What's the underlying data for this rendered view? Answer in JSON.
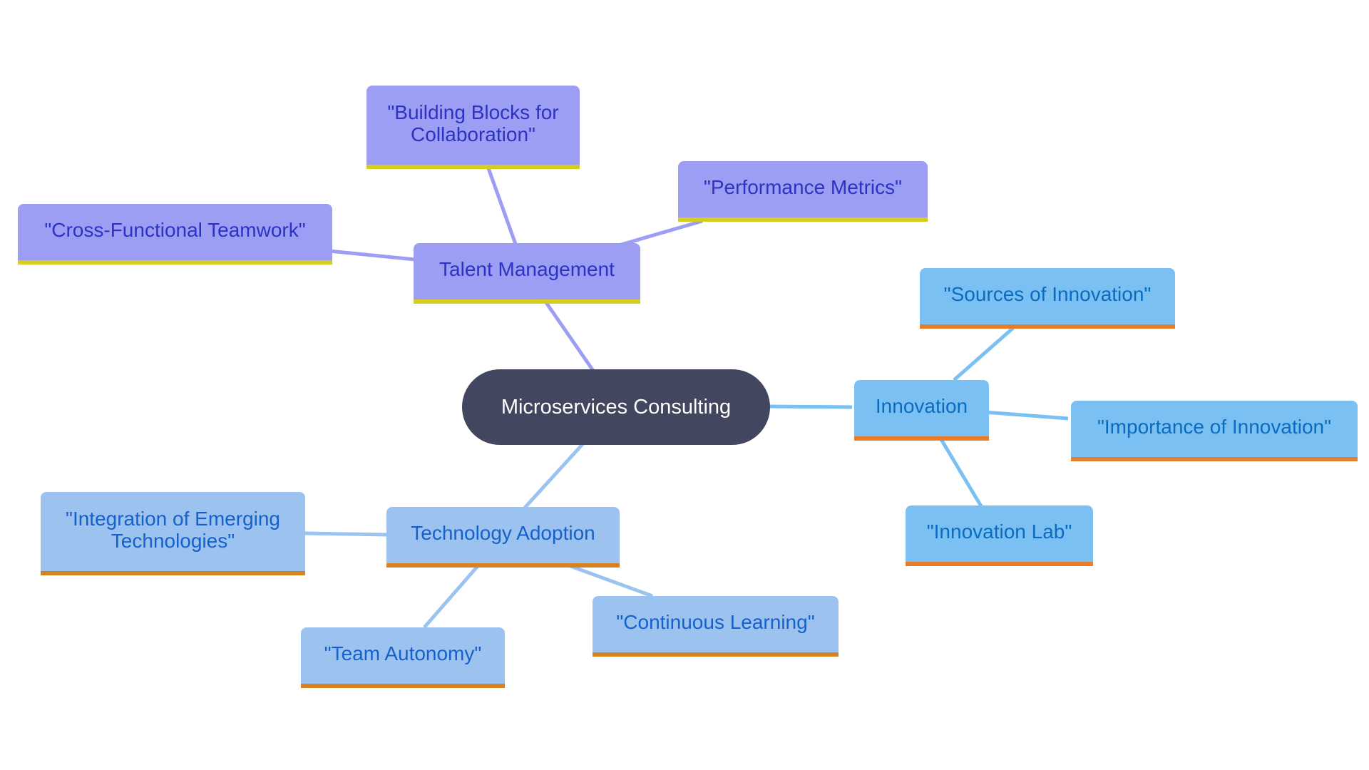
{
  "diagram": {
    "type": "mindmap",
    "root": {
      "id": "root",
      "label": "Microservices Consulting"
    },
    "branches": [
      {
        "id": "talent",
        "label": "Talent Management",
        "style": "purple",
        "children": [
          {
            "id": "building",
            "label": "\"Building Blocks for Collaboration\""
          },
          {
            "id": "performance",
            "label": "\"Performance Metrics\""
          },
          {
            "id": "crossfunc",
            "label": "\"Cross-Functional Teamwork\""
          }
        ]
      },
      {
        "id": "innovation",
        "label": "Innovation",
        "style": "sky",
        "children": [
          {
            "id": "sources",
            "label": "\"Sources of Innovation\""
          },
          {
            "id": "importance",
            "label": "\"Importance of Innovation\""
          },
          {
            "id": "lab",
            "label": "\"Innovation Lab\""
          }
        ]
      },
      {
        "id": "tech",
        "label": "Technology Adoption",
        "style": "lightblue",
        "children": [
          {
            "id": "integration",
            "label": "\"Integration of Emerging Technologies\""
          },
          {
            "id": "autonomy",
            "label": "\"Team Autonomy\""
          },
          {
            "id": "learning",
            "label": "\"Continuous Learning\""
          }
        ]
      }
    ]
  },
  "colors": {
    "root_fill": "#42465e",
    "purple_fill": "#9b9ef2",
    "purple_text": "#2c32c4",
    "purple_accent": "#d6cd21",
    "sky_fill": "#7bc0f2",
    "sky_text": "#0a6bbf",
    "sky_accent": "#e87e2b",
    "lightblue_fill": "#9cc3f0",
    "lightblue_text": "#1660c9",
    "lightblue_accent": "#d6821f"
  }
}
